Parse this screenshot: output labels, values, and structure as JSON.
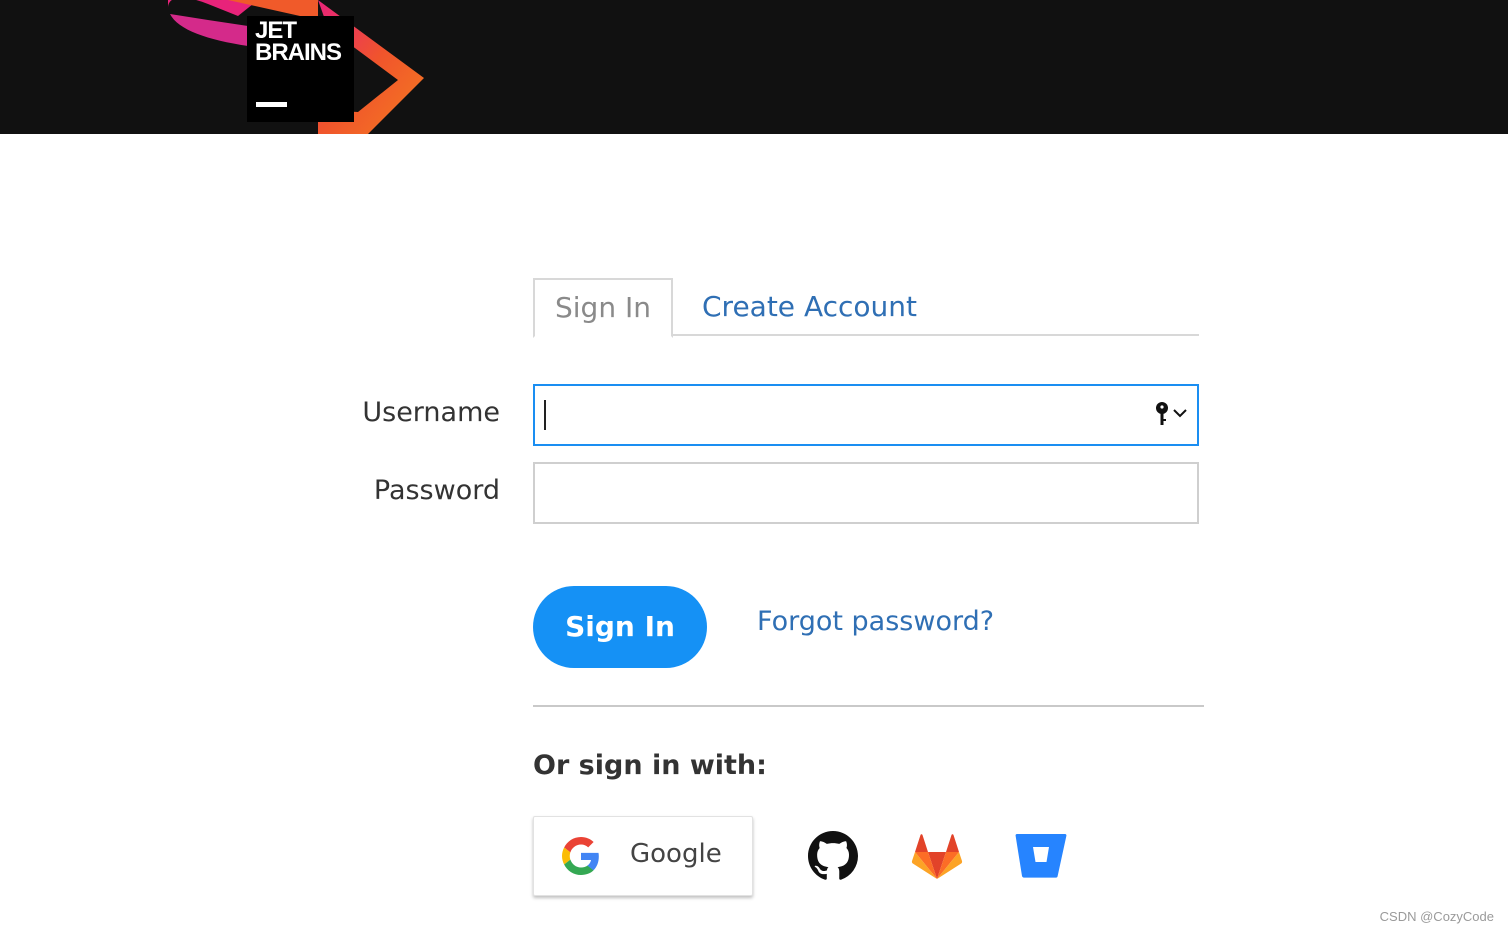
{
  "header": {
    "logo_text": "JET\nBRAINS"
  },
  "tabs": {
    "sign_in": "Sign In",
    "create_account": "Create Account"
  },
  "form": {
    "username_label": "Username",
    "username_value": "",
    "password_label": "Password",
    "password_value": ""
  },
  "actions": {
    "sign_in_button": "Sign In",
    "forgot_password": "Forgot password?"
  },
  "social": {
    "heading": "Or sign in with:",
    "google_label": "Google",
    "providers": [
      "github-icon",
      "gitlab-icon",
      "bitbucket-icon"
    ]
  },
  "colors": {
    "accent": "#1591f5",
    "link": "#2f6fb4",
    "header_bg": "#111111"
  },
  "watermark": "CSDN @CozyCode"
}
